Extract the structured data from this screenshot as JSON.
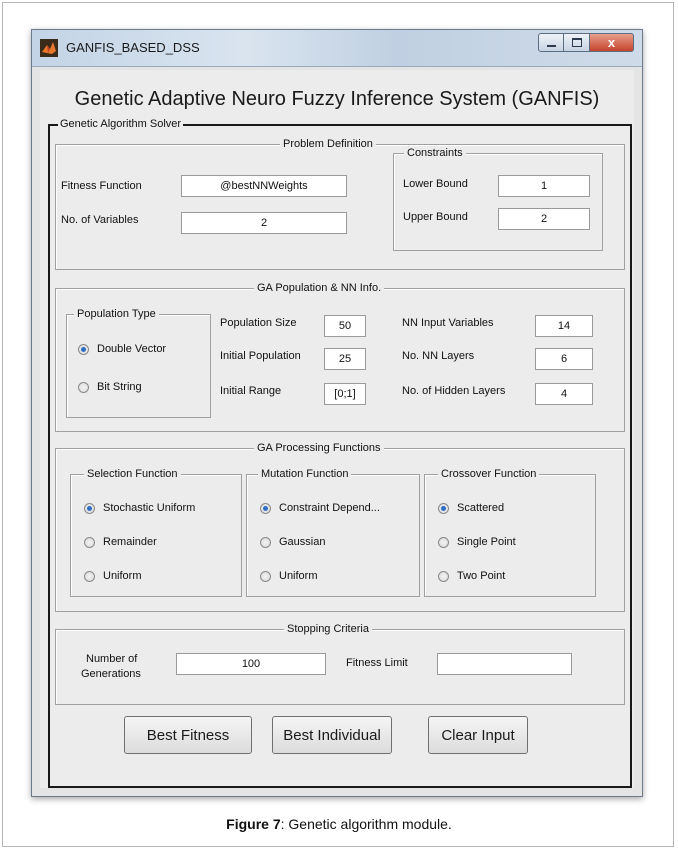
{
  "window": {
    "title": "GANFIS_BASED_DSS",
    "close_glyph": "x"
  },
  "heading": "Genetic Adaptive Neuro Fuzzy Inference System (GANFIS)",
  "solver_label": "Genetic Algorithm Solver",
  "problem": {
    "title": "Problem Definition",
    "fitness_label": "Fitness Function",
    "fitness_value": "@bestNNWeights",
    "vars_label": "No. of Variables",
    "vars_value": "2",
    "constraints": {
      "title": "Constraints",
      "lower_label": "Lower Bound",
      "lower_value": "1",
      "upper_label": "Upper Bound",
      "upper_value": "2"
    }
  },
  "population": {
    "title": "GA Population & NN Info.",
    "type_title": "Population Type",
    "type_options": [
      "Double Vector",
      "Bit String"
    ],
    "type_selected": 0,
    "size_label": "Population Size",
    "size_value": "50",
    "initial_label": "Initial Population",
    "initial_value": "25",
    "range_label": "Initial Range",
    "range_value": "[0;1]",
    "nn_inputs_label": "NN Input Variables",
    "nn_inputs_value": "14",
    "nn_layers_label": "No. NN Layers",
    "nn_layers_value": "6",
    "hidden_label": "No. of Hidden Layers",
    "hidden_value": "4"
  },
  "processing": {
    "title": "GA Processing Functions",
    "selection": {
      "title": "Selection Function",
      "options": [
        "Stochastic Uniform",
        "Remainder",
        "Uniform"
      ],
      "selected": 0
    },
    "mutation": {
      "title": "Mutation Function",
      "options": [
        "Constraint Depend...",
        "Gaussian",
        "Uniform"
      ],
      "selected": 0
    },
    "crossover": {
      "title": "Crossover Function",
      "options": [
        "Scattered",
        "Single Point",
        "Two Point"
      ],
      "selected": 0
    }
  },
  "stopping": {
    "title": "Stopping Criteria",
    "generations_label_1": "Number of",
    "generations_label_2": "Generations",
    "generations_value": "100",
    "fitness_limit_label": "Fitness Limit",
    "fitness_limit_value": ""
  },
  "buttons": {
    "best_fitness": "Best Fitness",
    "best_individual": "Best Individual",
    "clear_input": "Clear Input"
  },
  "caption": {
    "bold": "Figure 7",
    "rest": ": Genetic algorithm module."
  },
  "icons": {
    "app": "matlab-icon",
    "minimize": "minimize-icon",
    "maximize": "maximize-icon",
    "close": "close-icon"
  }
}
